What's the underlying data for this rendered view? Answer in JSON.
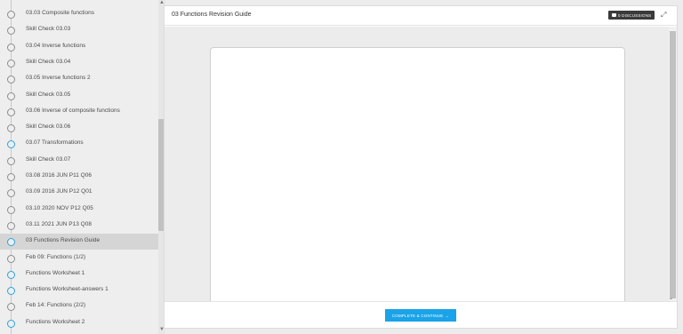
{
  "sidebar": {
    "items": [
      {
        "label": "03.03 Composite functions",
        "state": "normal"
      },
      {
        "label": "Skill Check 03.03",
        "state": "normal"
      },
      {
        "label": "03.04 Inverse functions",
        "state": "normal"
      },
      {
        "label": "Skill Check 03.04",
        "state": "normal"
      },
      {
        "label": "03.05 Inverse functions 2",
        "state": "normal"
      },
      {
        "label": "Skill Check 03.05",
        "state": "normal"
      },
      {
        "label": "03.06 Inverse of composite functions",
        "state": "normal"
      },
      {
        "label": "Skill Check 03.06",
        "state": "normal"
      },
      {
        "label": "03.07 Transformations",
        "state": "blue"
      },
      {
        "label": "Skill Check 03.07",
        "state": "normal"
      },
      {
        "label": "03.08 2016 JUN P11 Q06",
        "state": "normal"
      },
      {
        "label": "03.09 2016 JUN P12 Q01",
        "state": "normal"
      },
      {
        "label": "03.10 2020 NOV P12 Q05",
        "state": "normal"
      },
      {
        "label": "03.11 2021 JUN P13 Q08",
        "state": "normal"
      },
      {
        "label": "03 Functions Revision Guide",
        "state": "active"
      },
      {
        "label": "Feb 09: Functions (1/2)",
        "state": "normal"
      },
      {
        "label": "Functions Worksheet 1",
        "state": "blue"
      },
      {
        "label": "Functions Worksheet-answers 1",
        "state": "blue"
      },
      {
        "label": "Feb 14: Functions (2/2)",
        "state": "normal"
      },
      {
        "label": "Functions Worksheet 2",
        "state": "blue"
      }
    ]
  },
  "header": {
    "title": "03 Functions Revision Guide",
    "discussions_label": "0 DISCUSSIONS",
    "expand_icon": "expand-icon"
  },
  "footer": {
    "complete_label": "COMPLETE & CONTINUE",
    "arrow": "→"
  },
  "colors": {
    "accent": "#1aa3e8",
    "active_row": "#d5d5d5",
    "discussions_bg": "#3a3a3a"
  }
}
